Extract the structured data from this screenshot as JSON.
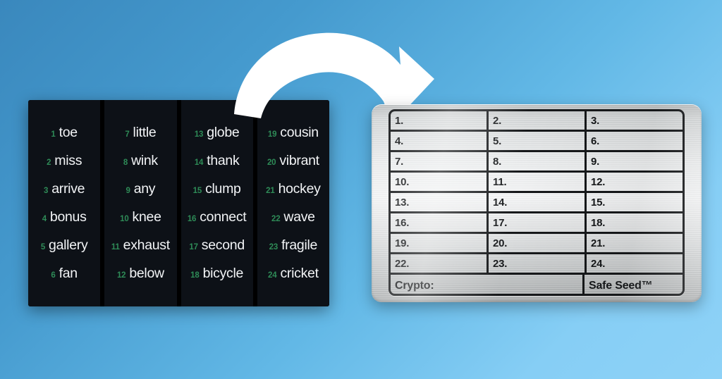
{
  "background": {
    "gradient_from": "#3a88bd",
    "gradient_to": "#8ed2f7"
  },
  "arrow": {
    "name": "curved-arrow",
    "color": "#ffffff",
    "direction": "left-to-right-curved-down"
  },
  "word_panel": {
    "background": "#0d1117",
    "number_color": "#2e8b57",
    "word_color": "#f2f4f6",
    "columns": [
      {
        "words": [
          {
            "num": "1",
            "word": "toe"
          },
          {
            "num": "2",
            "word": "miss"
          },
          {
            "num": "3",
            "word": "arrive"
          },
          {
            "num": "4",
            "word": "bonus"
          },
          {
            "num": "5",
            "word": "gallery"
          },
          {
            "num": "6",
            "word": "fan"
          }
        ]
      },
      {
        "words": [
          {
            "num": "7",
            "word": "little"
          },
          {
            "num": "8",
            "word": "wink"
          },
          {
            "num": "9",
            "word": "any"
          },
          {
            "num": "10",
            "word": "knee"
          },
          {
            "num": "11",
            "word": "exhaust"
          },
          {
            "num": "12",
            "word": "below"
          }
        ]
      },
      {
        "words": [
          {
            "num": "13",
            "word": "globe"
          },
          {
            "num": "14",
            "word": "thank"
          },
          {
            "num": "15",
            "word": "clump"
          },
          {
            "num": "16",
            "word": "connect"
          },
          {
            "num": "17",
            "word": "second"
          },
          {
            "num": "18",
            "word": "bicycle"
          }
        ]
      },
      {
        "words": [
          {
            "num": "19",
            "word": "cousin"
          },
          {
            "num": "20",
            "word": "vibrant"
          },
          {
            "num": "21",
            "word": "hockey"
          },
          {
            "num": "22",
            "word": "wave"
          },
          {
            "num": "23",
            "word": "fragile"
          },
          {
            "num": "24",
            "word": "cricket"
          }
        ]
      }
    ]
  },
  "metal_plate": {
    "metal_color": "#d8dadb",
    "border_color": "#16181a",
    "rows": [
      [
        "1.",
        "2.",
        "3."
      ],
      [
        "4.",
        "5.",
        "6."
      ],
      [
        "7.",
        "8.",
        "9."
      ],
      [
        "10.",
        "11.",
        "12."
      ],
      [
        "13.",
        "14.",
        "15."
      ],
      [
        "16.",
        "17.",
        "18."
      ],
      [
        "19.",
        "20.",
        "21."
      ],
      [
        "22.",
        "23.",
        "24."
      ]
    ],
    "footer": {
      "crypto_label": "Crypto:",
      "brand_label": "Safe Seed™"
    }
  }
}
